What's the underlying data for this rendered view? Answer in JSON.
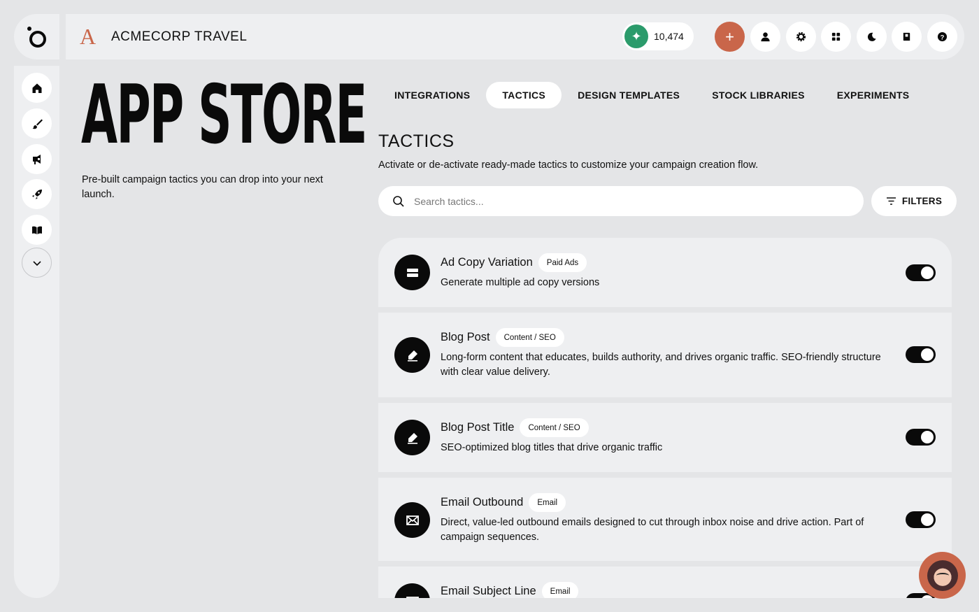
{
  "header": {
    "brand_mark": "A",
    "brand_name": "ACMECORP TRAVEL",
    "credits": "10,474",
    "icons": [
      "sparkle-icon",
      "plus-icon",
      "user-icon",
      "settings-icon",
      "apps-grid-icon",
      "dark-mode-icon",
      "book-icon",
      "help-icon"
    ]
  },
  "sidebar": {
    "items": [
      "home-icon",
      "brush-icon",
      "megaphone-icon",
      "rocket-icon",
      "book-open-icon",
      "chevron-down-icon"
    ]
  },
  "hero": {
    "title": "APP STORE",
    "subtitle": "Pre-built campaign tactics you can drop into your next launch."
  },
  "tabs": [
    {
      "label": "INTEGRATIONS",
      "active": false
    },
    {
      "label": "TACTICS",
      "active": true
    },
    {
      "label": "DESIGN TEMPLATES",
      "active": false
    },
    {
      "label": "STOCK LIBRARIES",
      "active": false
    },
    {
      "label": "EXPERIMENTS",
      "active": false
    }
  ],
  "section": {
    "title": "TACTICS",
    "description": "Activate or de-activate ready-made tactics to customize your campaign creation flow."
  },
  "search": {
    "placeholder": "Search tactics...",
    "value": ""
  },
  "filters_label": "FILTERS",
  "tactics": [
    {
      "name": "Ad Copy Variation",
      "tag": "Paid Ads",
      "description": "Generate multiple ad copy versions",
      "enabled": true,
      "icon": "stack-icon"
    },
    {
      "name": "Blog Post",
      "tag": "Content / SEO",
      "description": "Long-form content that educates, builds authority, and drives organic traffic. SEO-friendly structure with clear value delivery.",
      "enabled": true,
      "icon": "edit-icon"
    },
    {
      "name": "Blog Post Title",
      "tag": "Content / SEO",
      "description": "SEO-optimized blog titles that drive organic traffic",
      "enabled": true,
      "icon": "edit-icon"
    },
    {
      "name": "Email Outbound",
      "tag": "Email",
      "description": "Direct, value-led outbound emails designed to cut through inbox noise and drive action. Part of campaign sequences.",
      "enabled": true,
      "icon": "envelope-icon"
    },
    {
      "name": "Email Subject Line",
      "tag": "Email",
      "description": "",
      "enabled": true,
      "icon": "envelope-icon"
    }
  ],
  "colors": {
    "accent": "#c9664a",
    "credits_green": "#2b9b6b",
    "background": "#e4e5e7",
    "panel": "#eeeff1"
  }
}
